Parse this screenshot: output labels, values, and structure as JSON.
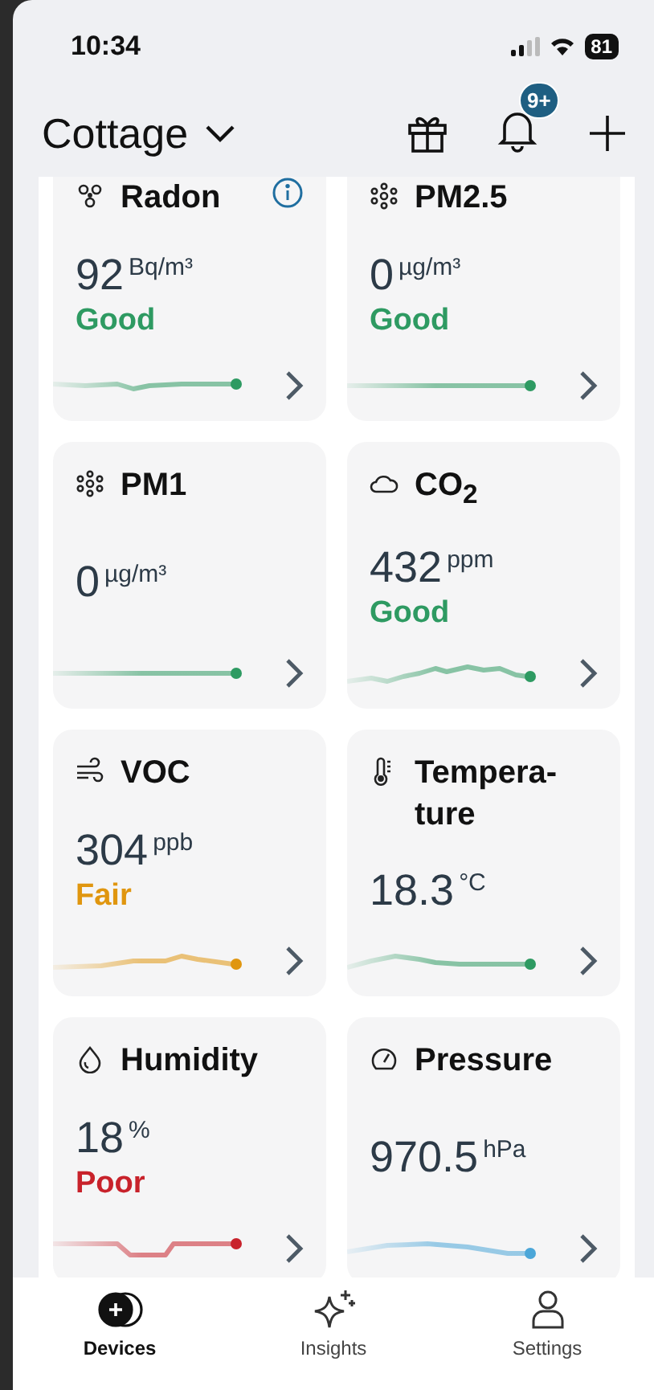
{
  "status_bar": {
    "time": "10:34",
    "battery": "81"
  },
  "header": {
    "title": "Cottage",
    "notification_badge": "9+"
  },
  "sensors": [
    {
      "kind": "radon",
      "title": "Radon",
      "info": true,
      "value": "92",
      "unit": "Bq/m³",
      "status": "Good",
      "color": "#2e9a62"
    },
    {
      "kind": "particles",
      "title": "PM2.5",
      "info": false,
      "value": "0",
      "unit": "µg/m³",
      "status": "Good",
      "color": "#2e9a62"
    },
    {
      "kind": "particles",
      "title": "PM1",
      "info": false,
      "value": "0",
      "unit": "µg/m³",
      "color": "#2e9a62"
    },
    {
      "kind": "cloud",
      "title": "CO$_{2}$",
      "info": false,
      "value": "432",
      "unit": "ppm",
      "status": "Good",
      "color": "#2e9a62"
    },
    {
      "kind": "wind",
      "title": "VOC",
      "info": false,
      "value": "304",
      "unit": "ppb",
      "status": "Fair",
      "color": "#e0960f"
    },
    {
      "kind": "thermometer",
      "title": "Tempera-ture",
      "info": false,
      "value": "18.3",
      "unit": "°C",
      "color": "#2e9a62"
    },
    {
      "kind": "drop",
      "title": "Humidity",
      "info": false,
      "value": "18",
      "unit": "%",
      "status": "Poor",
      "color": "#c8222b"
    },
    {
      "kind": "gauge",
      "title": "Pressure",
      "info": false,
      "value": "970.5",
      "unit": "hPa",
      "color": "#4ba6d8"
    }
  ],
  "tabs": [
    {
      "label": "Devices",
      "kind": "devices",
      "selected": true
    },
    {
      "label": "Insights",
      "kind": "insights",
      "selected": false
    },
    {
      "label": "Settings",
      "kind": "settings",
      "selected": false
    }
  ]
}
